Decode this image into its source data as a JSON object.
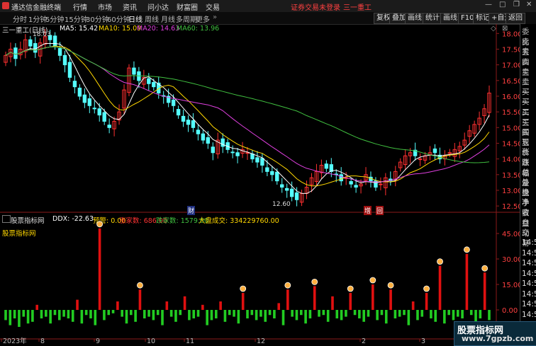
{
  "titlebar": {
    "app": "通达信金融终端",
    "menus": [
      "行情",
      "市场",
      "资讯",
      "问小达",
      "财富圈",
      "交易"
    ],
    "warning": "证券交易未登录",
    "stock_name": "三一重工"
  },
  "periods": [
    "分时",
    "1分钟",
    "5分钟",
    "15分钟",
    "30分钟",
    "60分钟",
    "日线",
    "周线",
    "月线",
    "多周期",
    "更多"
  ],
  "active_period": "日线",
  "toolbar_right": [
    "复权",
    "叠加",
    "画线",
    "统计",
    "画线",
    "F10",
    "标记",
    "+自选",
    "返回"
  ],
  "main_chart": {
    "title": "三一重工(日线)",
    "ma": [
      {
        "label": "MA5: 15.42",
        "color": "#ffffff"
      },
      {
        "label": "MA10: 15.09",
        "color": "#ffd700"
      },
      {
        "label": "MA20: 14.63",
        "color": "#e040e0"
      },
      {
        "label": "MA60: 13.96",
        "color": "#40c040"
      }
    ],
    "max_label": "18.03",
    "min_label": "12.60",
    "price_ticks": [
      "18.00",
      "17.50",
      "17.00",
      "16.50",
      "16.00",
      "15.50",
      "15.00",
      "14.50",
      "14.00",
      "13.50",
      "13.00",
      "12.50"
    ],
    "markers": [
      "财",
      "增",
      "回"
    ]
  },
  "indicator": {
    "name": "股票指标网",
    "items": [
      {
        "label": "DDX: -22.63",
        "color": "#ffffff"
      },
      {
        "label": "预警: 0.00",
        "color": "#ffd700"
      },
      {
        "label": "涨家数: 686.00",
        "color": "#ff3333"
      },
      {
        "label": "跌家数: 1579.00",
        "color": "#40c040"
      },
      {
        "label": "大盘成交: 334229760.00",
        "color": "#ffd700"
      }
    ],
    "ticks": [
      "45.00",
      "30.00",
      "15.00",
      "0.00"
    ]
  },
  "date_axis": [
    "2023年",
    "8",
    "9",
    "10",
    "11",
    "12",
    "2",
    "3"
  ],
  "right_panel": {
    "labels": [
      "委比",
      "卖五",
      "卖四",
      "卖三",
      "卖二",
      "卖一",
      "买一",
      "买二",
      "买三",
      "买四",
      "买五",
      "现价",
      "涨跌",
      "涨幅",
      "总量",
      "外盘",
      "换手",
      "净资",
      "收益"
    ],
    "label2": [
      "自动",
      "交易"
    ],
    "times": [
      "14:50",
      "14:50",
      "14:50",
      "14:50",
      "14:50",
      "14:50",
      "14:50",
      "14:50",
      "14:50",
      "14:50"
    ]
  },
  "watermark": {
    "line1": "股票指标网",
    "line2": "www.7gpzb.com"
  },
  "chart_data": [
    {
      "type": "candlestick",
      "title": "三一重工(日线)",
      "ylim": [
        12.3,
        18.3
      ],
      "close": [
        17.3,
        17.5,
        17.2,
        17.5,
        17.8,
        17.6,
        17.4,
        17.7,
        17.9,
        17.8,
        17.6,
        17.3,
        17.0,
        16.6,
        16.3,
        16.0,
        15.8,
        15.7,
        15.6,
        15.4,
        15.2,
        15.0,
        15.2,
        15.5,
        16.2,
        16.9,
        16.7,
        16.5,
        16.6,
        16.4,
        16.3,
        16.1,
        16.0,
        15.8,
        15.7,
        15.4,
        15.2,
        15.1,
        15.0,
        14.8,
        14.6,
        14.5,
        14.2,
        14.6,
        14.4,
        14.3,
        14.2,
        14.1,
        14.3,
        14.2,
        14.0,
        13.9,
        13.8,
        13.6,
        13.5,
        13.3,
        13.1,
        13.0,
        12.8,
        12.7,
        12.9,
        13.1,
        13.4,
        13.6,
        13.8,
        13.7,
        13.6,
        13.5,
        13.3,
        13.4,
        13.2,
        13.1,
        13.2,
        13.5,
        13.3,
        13.1,
        13.2,
        13.4,
        13.3,
        13.6,
        13.9,
        14.1,
        14.2,
        14.1,
        14.0,
        14.1,
        14.2,
        14.2,
        14.0,
        14.1,
        14.2,
        14.3,
        14.4,
        14.6,
        14.9,
        15.1,
        15.3,
        15.6,
        16.1
      ],
      "ma": {
        "MA5": 15.42,
        "MA10": 15.09,
        "MA20": 14.63,
        "MA60": 13.96
      },
      "max": 18.03,
      "min": 12.6
    },
    {
      "type": "bar",
      "title": "DDX",
      "ylim": [
        -15,
        50
      ],
      "values": [
        -6,
        -9,
        -5,
        -10,
        -4,
        -8,
        -7,
        3,
        -5,
        -4,
        -8,
        -3,
        -6,
        -4,
        -5,
        -7,
        6,
        -8,
        -3,
        -5,
        -9,
        48,
        -6,
        -3,
        -2,
        5,
        -4,
        -8,
        -3,
        -7,
        12,
        -5,
        -4,
        -6,
        -3,
        -9,
        5,
        -4,
        -7,
        -3,
        8,
        -6,
        -5,
        -4,
        3,
        -9,
        -6,
        -5,
        5,
        -7,
        -3,
        -4,
        -8,
        10,
        -5,
        -3,
        -6,
        -4,
        -7,
        -3,
        -5,
        4,
        -9,
        12,
        -4,
        -6,
        -3,
        -8,
        -5,
        14,
        -4,
        -3,
        -7,
        8,
        -5,
        -6,
        -4,
        10,
        -3,
        -5,
        -7,
        -4,
        15,
        -6,
        -3,
        -8,
        12,
        -5,
        -4,
        -3,
        -9,
        5,
        -6,
        -4,
        10,
        -5,
        -7,
        26,
        -8,
        -3,
        -6,
        -4,
        -5,
        33,
        -3,
        -9,
        -5,
        22,
        -6
      ]
    }
  ]
}
